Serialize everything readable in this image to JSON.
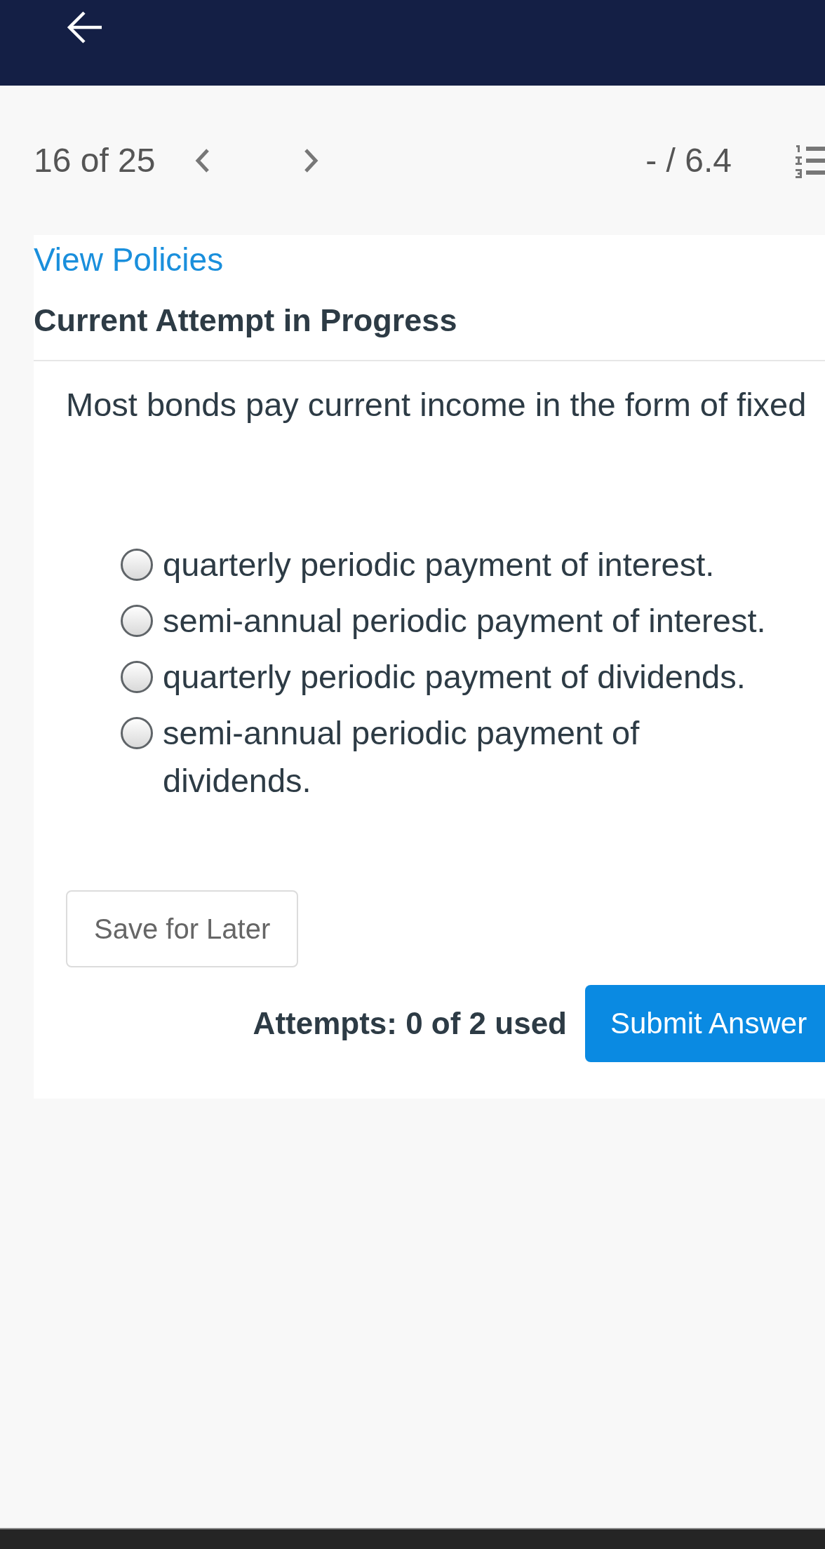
{
  "navigation": {
    "position": "16 of 25",
    "score": "- / 6.4"
  },
  "policies_link": "View Policies",
  "attempt_heading": "Current Attempt in Progress",
  "question": {
    "prompt": "Most bonds pay current income in the form of fixed",
    "options": [
      {
        "text": "quarterly periodic payment of interest.",
        "selected": false
      },
      {
        "text": "semi-annual periodic payment of interest.",
        "selected": false
      },
      {
        "text": "quarterly periodic payment of dividends.",
        "selected": false
      },
      {
        "text": "semi-annual periodic payment of dividends.",
        "selected": false
      }
    ]
  },
  "save_button": "Save for Later",
  "attempts": "Attempts: 0 of 2 used",
  "submit_button": "Submit Answer"
}
